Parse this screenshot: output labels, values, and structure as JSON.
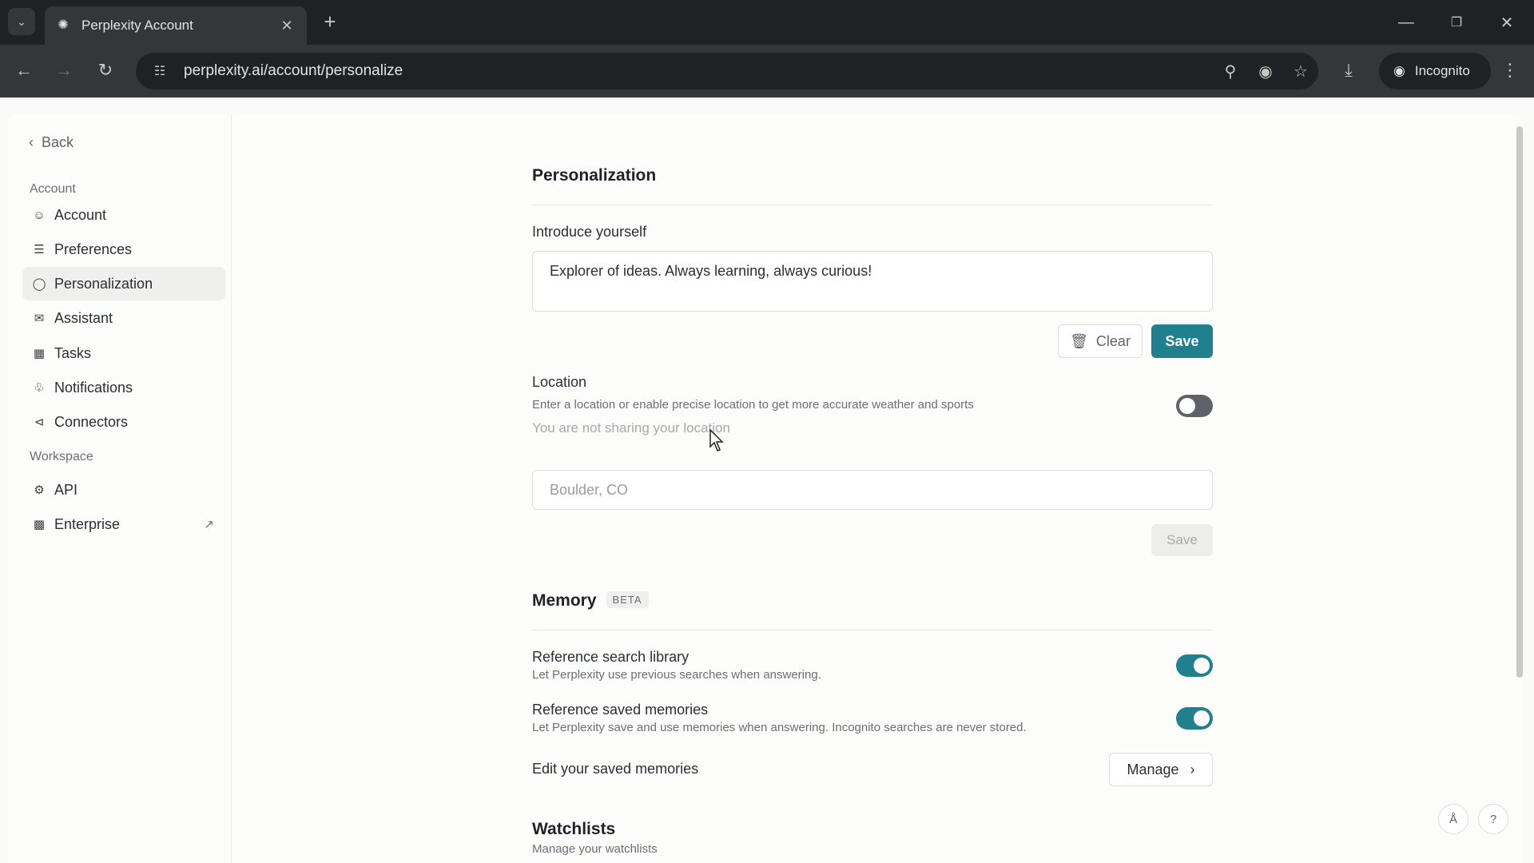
{
  "browser": {
    "tab_title": "Perplexity Account",
    "url": "perplexity.ai/account/personalize",
    "incognito_label": "Incognito"
  },
  "sidebar": {
    "back_label": "Back",
    "account_section": "Account",
    "items": [
      {
        "label": "Account",
        "icon": "user-circle-icon"
      },
      {
        "label": "Preferences",
        "icon": "sliders-icon"
      },
      {
        "label": "Personalization",
        "icon": "toggle-icon",
        "active": true
      },
      {
        "label": "Assistant",
        "icon": "mail-icon"
      },
      {
        "label": "Tasks",
        "icon": "calendar-icon"
      },
      {
        "label": "Notifications",
        "icon": "bell-icon"
      },
      {
        "label": "Connectors",
        "icon": "share-nodes-icon"
      }
    ],
    "workspace_section": "Workspace",
    "workspace_items": [
      {
        "label": "API",
        "icon": "api-icon"
      },
      {
        "label": "Enterprise",
        "icon": "building-icon",
        "external": true
      }
    ]
  },
  "main": {
    "title": "Personalization",
    "introduce": {
      "label": "Introduce yourself",
      "value": "Explorer of ideas. Always learning, always curious!",
      "clear_label": "Clear",
      "save_label": "Save"
    },
    "location": {
      "label": "Location",
      "description": "Enter a location or enable precise location to get more accurate weather and sports",
      "status": "You are not sharing your location",
      "enabled": false,
      "placeholder": "Boulder, CO",
      "save_label": "Save"
    },
    "memory": {
      "title": "Memory",
      "badge": "BETA",
      "items": [
        {
          "label": "Reference search library",
          "description": "Let Perplexity use previous searches when answering.",
          "enabled": true
        },
        {
          "label": "Reference saved memories",
          "description": "Let Perplexity save and use memories when answering. Incognito searches are never stored.",
          "enabled": true
        }
      ],
      "edit_label": "Edit your saved memories",
      "manage_label": "Manage"
    },
    "watchlists": {
      "title": "Watchlists",
      "description": "Manage your watchlists"
    }
  },
  "colors": {
    "accent": "#20808d",
    "toggle_off": "#5f6368"
  }
}
